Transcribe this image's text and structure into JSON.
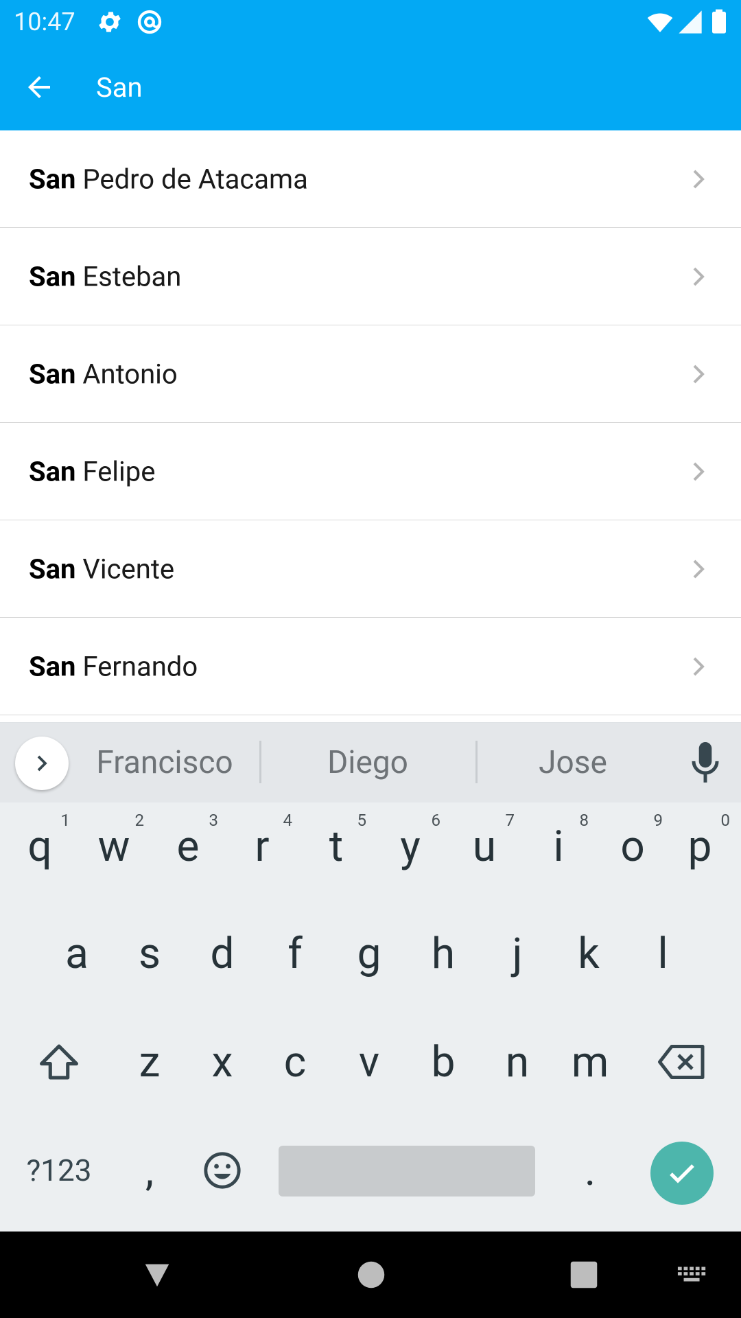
{
  "status_bar": {
    "time": "10:47",
    "icons": [
      "settings-icon",
      "at-sign-icon",
      "wifi-icon",
      "cellular-signal-icon",
      "battery-icon"
    ]
  },
  "toolbar": {
    "query": "San",
    "back_icon": "arrow-back-icon"
  },
  "results": [
    {
      "bold": "San",
      "rest": " Pedro de Atacama"
    },
    {
      "bold": "San",
      "rest": " Esteban"
    },
    {
      "bold": "San",
      "rest": " Antonio"
    },
    {
      "bold": "San",
      "rest": " Felipe"
    },
    {
      "bold": "San",
      "rest": " Vicente"
    },
    {
      "bold": "San",
      "rest": " Fernando"
    }
  ],
  "keyboard": {
    "suggestions": [
      "Francisco",
      "Diego",
      "Jose"
    ],
    "row1": [
      {
        "k": "q",
        "h": "1"
      },
      {
        "k": "w",
        "h": "2"
      },
      {
        "k": "e",
        "h": "3"
      },
      {
        "k": "r",
        "h": "4"
      },
      {
        "k": "t",
        "h": "5"
      },
      {
        "k": "y",
        "h": "6"
      },
      {
        "k": "u",
        "h": "7"
      },
      {
        "k": "i",
        "h": "8"
      },
      {
        "k": "o",
        "h": "9"
      },
      {
        "k": "p",
        "h": "0"
      }
    ],
    "row2": [
      "a",
      "s",
      "d",
      "f",
      "g",
      "h",
      "j",
      "k",
      "l"
    ],
    "row3": [
      "z",
      "x",
      "c",
      "v",
      "b",
      "n",
      "m"
    ],
    "symbols_key": "?123",
    "comma_key": ",",
    "period_key": ".",
    "emoji_icon": "emoji-icon",
    "shift_icon": "shift-icon",
    "backspace_icon": "backspace-icon",
    "enter_icon": "checkmark-icon",
    "enter_color": "#4db6ac"
  },
  "nav_bar": {
    "icons": [
      "back-triangle-icon",
      "home-circle-icon",
      "recents-square-icon",
      "keyboard-switch-icon"
    ]
  },
  "colors": {
    "accent": "#03a9f4",
    "keyboard_bg": "#eceff1"
  }
}
